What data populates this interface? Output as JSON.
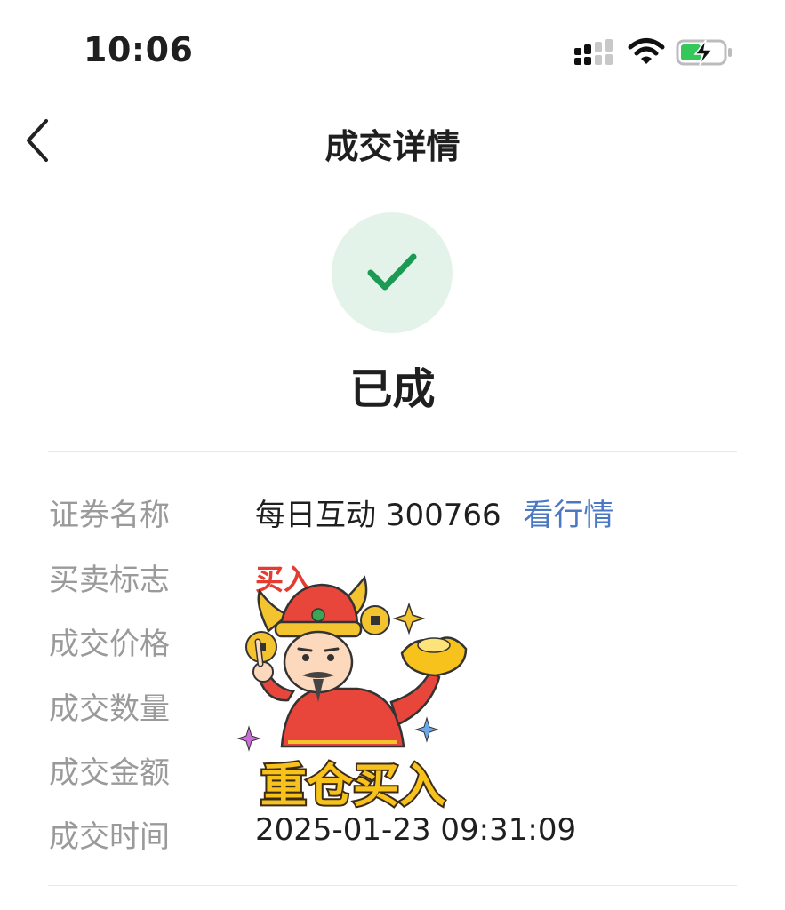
{
  "status_bar": {
    "time": "10:06"
  },
  "nav": {
    "title": "成交详情"
  },
  "status": {
    "title": "已成"
  },
  "details": {
    "security_label": "证券名称",
    "security_name": "每日互动",
    "security_code": "300766",
    "quote_link": "看行情",
    "side_label": "买卖标志",
    "side_value": "买入",
    "price_label": "成交价格",
    "quantity_label": "成交数量",
    "amount_label": "成交金额",
    "time_label": "成交时间",
    "time_value": "2025-01-23 09:31:09"
  },
  "sticker": {
    "caption": "重仓买入"
  },
  "colors": {
    "success_bg": "#e4f3e9",
    "success_check": "#1a9a52",
    "link": "#4a78c2",
    "buy": "#e43d30",
    "label": "#9a9a9a"
  }
}
